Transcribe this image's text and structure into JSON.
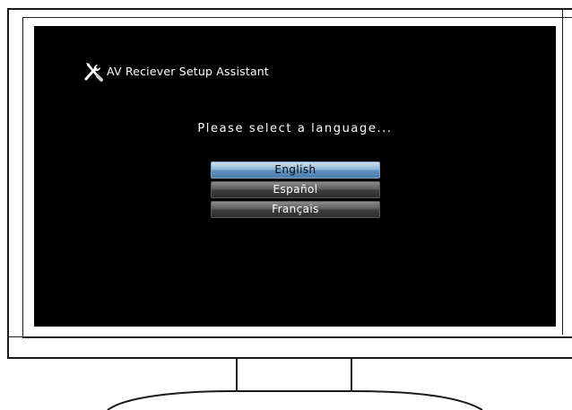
{
  "screen": {
    "app_title": "AV Reciever Setup Assistant",
    "app_icon": "tools-icon",
    "prompt": "Please select a language...",
    "languages": [
      {
        "label": "English",
        "selected": true
      },
      {
        "label": "Español",
        "selected": false
      },
      {
        "label": "Français",
        "selected": false
      }
    ]
  },
  "colors": {
    "screen_background": "#000000",
    "selected_button": "#6f9cc6",
    "unselected_button": "#4a4a4a",
    "text": "#ffffff"
  }
}
